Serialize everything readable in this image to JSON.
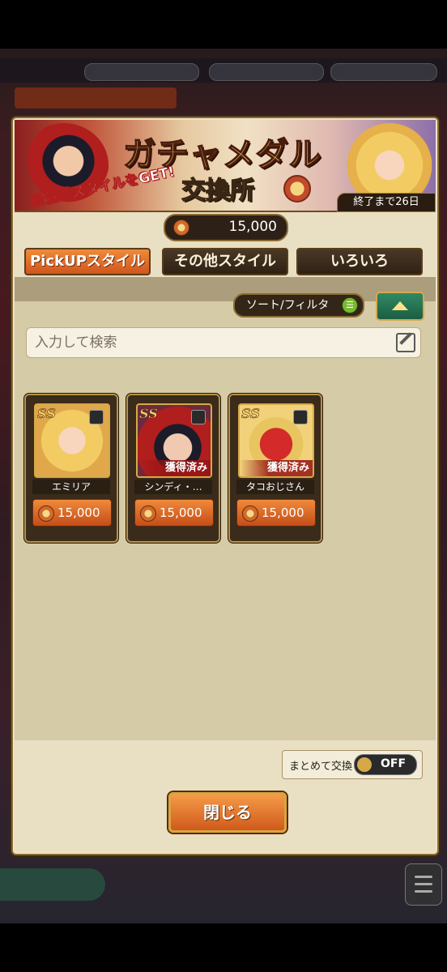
{
  "banner": {
    "title": "ガチャメダル",
    "subtitle": "交換所",
    "tagline": "新登場スタイルをGET!",
    "deadline": "終了まで26日"
  },
  "medal_balance": "15,000",
  "tabs": [
    {
      "label": "PickUPスタイル",
      "active": true
    },
    {
      "label": "その他スタイル",
      "active": false
    },
    {
      "label": "いろいろ",
      "active": false
    }
  ],
  "sort_filter": {
    "label": "ソート/フィルタ"
  },
  "search": {
    "placeholder": "入力して検索"
  },
  "cards": [
    {
      "rank": "SS",
      "name": "エミリア",
      "price": "15,000",
      "owned": ""
    },
    {
      "rank": "SS",
      "name": "シンディ・…",
      "price": "15,000",
      "owned": "獲得済み"
    },
    {
      "rank": "SS",
      "name": "タコおじさん",
      "price": "15,000",
      "owned": "獲得済み"
    }
  ],
  "bulk_exchange": {
    "label": "まとめて交換",
    "state": "OFF"
  },
  "close_button": {
    "label": "閉じる"
  }
}
